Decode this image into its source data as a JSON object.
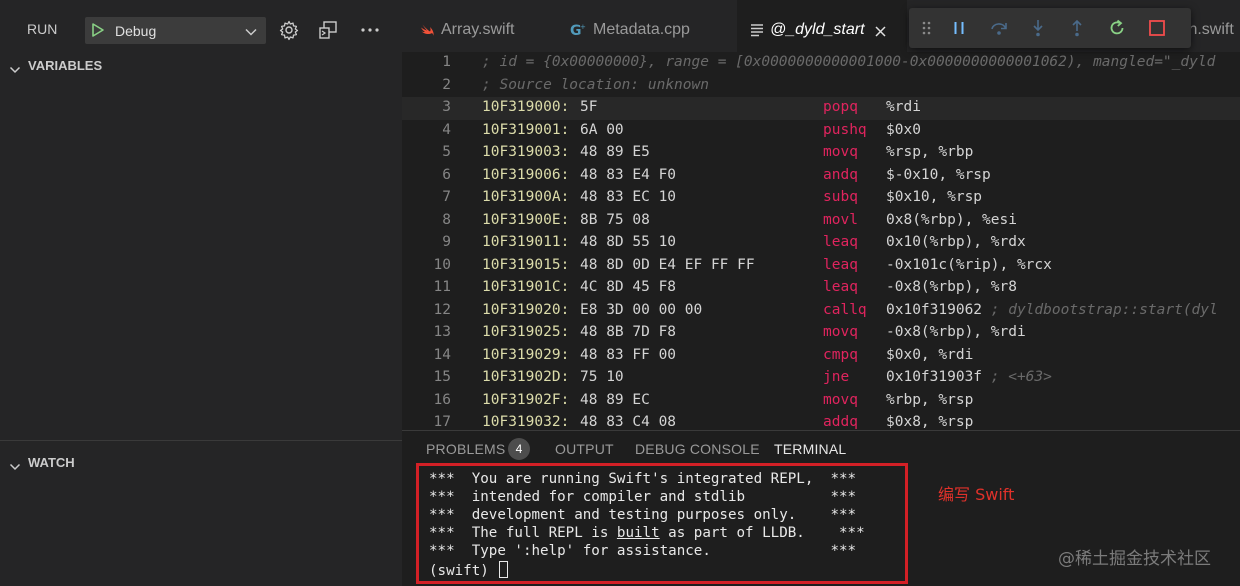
{
  "sidebar": {
    "run_label": "RUN",
    "debug_config": "Debug",
    "variables_title": "VARIABLES",
    "watch_title": "WATCH"
  },
  "tabs": [
    {
      "label": "Array.swift",
      "icon": "swift-icon"
    },
    {
      "label": "Metadata.cpp",
      "icon": "cpp-icon"
    },
    {
      "label": "@_dyld_start",
      "icon": "list-icon",
      "active": true
    },
    {
      "label": "ion.swift",
      "icon": "none"
    }
  ],
  "code": {
    "header1": "; id = {0x00000000}, range = [0x0000000000001000-0x0000000000001062), mangled=\"_dyld",
    "header2": "; Source location: unknown",
    "lines": [
      {
        "n": "3",
        "addr": "10F319000:",
        "bytes": "5F",
        "mn": "popq",
        "op": "%rdi"
      },
      {
        "n": "4",
        "addr": "10F319001:",
        "bytes": "6A 00",
        "mn": "pushq",
        "op": "$0x0"
      },
      {
        "n": "5",
        "addr": "10F319003:",
        "bytes": "48 89 E5",
        "mn": "movq",
        "op": "%rsp, %rbp"
      },
      {
        "n": "6",
        "addr": "10F319006:",
        "bytes": "48 83 E4 F0",
        "mn": "andq",
        "op": "$-0x10, %rsp"
      },
      {
        "n": "7",
        "addr": "10F31900A:",
        "bytes": "48 83 EC 10",
        "mn": "subq",
        "op": "$0x10, %rsp"
      },
      {
        "n": "8",
        "addr": "10F31900E:",
        "bytes": "8B 75 08",
        "mn": "movl",
        "op": "0x8(%rbp), %esi"
      },
      {
        "n": "9",
        "addr": "10F319011:",
        "bytes": "48 8D 55 10",
        "mn": "leaq",
        "op": "0x10(%rbp), %rdx"
      },
      {
        "n": "10",
        "addr": "10F319015:",
        "bytes": "48 8D 0D E4 EF FF FF",
        "mn": "leaq",
        "op": "-0x101c(%rip), %rcx"
      },
      {
        "n": "11",
        "addr": "10F31901C:",
        "bytes": "4C 8D 45 F8",
        "mn": "leaq",
        "op": "-0x8(%rbp), %r8"
      },
      {
        "n": "12",
        "addr": "10F319020:",
        "bytes": "E8 3D 00 00 00",
        "mn": "callq",
        "op": "0x10f319062",
        "cmt": " ; dyldbootstrap::start(dyl"
      },
      {
        "n": "13",
        "addr": "10F319025:",
        "bytes": "48 8B 7D F8",
        "mn": "movq",
        "op": "-0x8(%rbp), %rdi"
      },
      {
        "n": "14",
        "addr": "10F319029:",
        "bytes": "48 83 FF 00",
        "mn": "cmpq",
        "op": "$0x0, %rdi"
      },
      {
        "n": "15",
        "addr": "10F31902D:",
        "bytes": "75 10",
        "mn": "jne",
        "op": "0x10f31903f",
        "cmt": " ; <+63>"
      },
      {
        "n": "16",
        "addr": "10F31902F:",
        "bytes": "48 89 EC",
        "mn": "movq",
        "op": "%rbp, %rsp"
      },
      {
        "n": "17",
        "addr": "10F319032:",
        "bytes": "48 83 C4 08",
        "mn": "addq",
        "op": "$0x8, %rsp"
      }
    ]
  },
  "panel": {
    "tabs": [
      "PROBLEMS",
      "OUTPUT",
      "DEBUG CONSOLE",
      "TERMINAL"
    ],
    "problems_count": "4",
    "terminal": {
      "l1": "***  You are running Swift's integrated REPL,  ***",
      "l2": "***  intended for compiler and stdlib          ***",
      "l3": "***  development and testing purposes only.    ***",
      "l4_a": "***  The full REPL is ",
      "l4_u": "built",
      "l4_b": " as part of LLDB.    ***",
      "l5": "***  Type ':help' for assistance.              ***",
      "prompt": "(swift) "
    },
    "annotation": "编写 Swift",
    "watermark": "@稀土掘金技术社区"
  },
  "colors": {
    "accent_red": "#d32026",
    "mnemonic": "#e0245e",
    "address": "#dcdcaa",
    "play_green": "#89d185"
  }
}
